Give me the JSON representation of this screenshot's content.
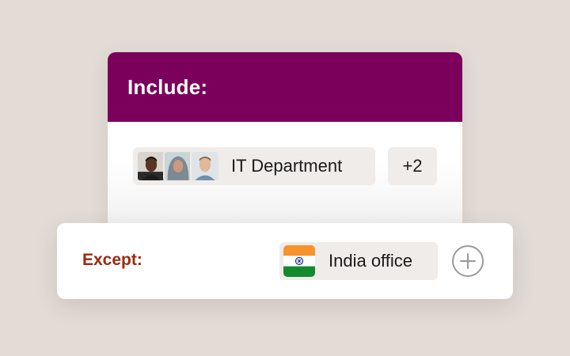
{
  "include": {
    "title": "Include:",
    "group": {
      "avatars": [
        "avatar-person-1",
        "avatar-person-2",
        "avatar-person-3"
      ],
      "label": "IT Department"
    },
    "more_label": "+2"
  },
  "except": {
    "title": "Except:",
    "location": {
      "flag_icon": "india-flag-icon",
      "label": "India office"
    },
    "add_icon": "plus-circle-icon"
  },
  "colors": {
    "header": "#7a005c",
    "except_label": "#9a2a10",
    "chip": "#f0ecea",
    "background": "#e3dcd6"
  }
}
